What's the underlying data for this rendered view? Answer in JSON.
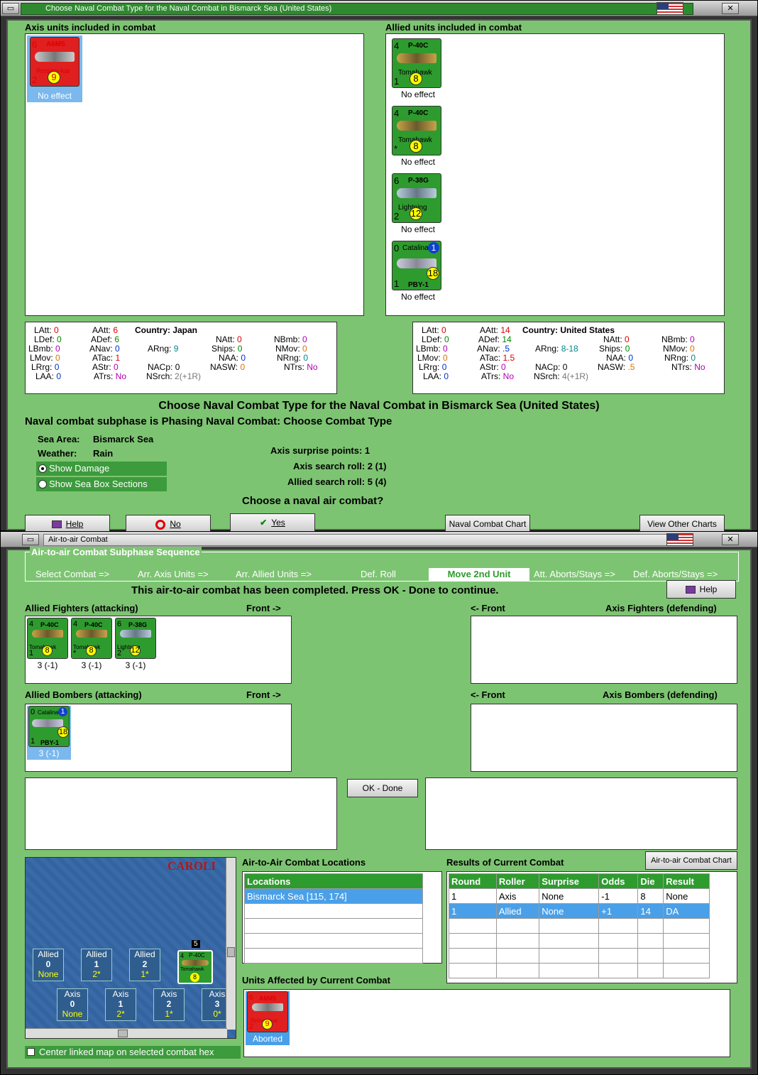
{
  "win1": {
    "title": "Choose Naval Combat Type for the Naval Combat in Bismarck Sea (United States)",
    "axis_label": "Axis units included in combat",
    "allied_label": "Allied units included in combat",
    "axis_units": [
      {
        "n1": "6",
        "name": "A6M5",
        "sub": "Reisen-kai",
        "n2": "2",
        "yellow": "9",
        "caption": "No effect"
      }
    ],
    "allied_units": [
      {
        "n1": "4",
        "name": "P-40C",
        "sub": "Tomahawk",
        "n2": "1",
        "yellow": "8",
        "caption": "No effect"
      },
      {
        "n1": "4",
        "name": "P-40C",
        "sub": "Tomahawk",
        "n2": "*",
        "yellow": "8",
        "caption": "No effect"
      },
      {
        "n1": "6",
        "name": "P-38G",
        "sub": "Lightning",
        "n2": "2",
        "yellow": "12",
        "caption": "No effect"
      },
      {
        "n1": "0",
        "name": "Catalina",
        "sub": "PBY-1",
        "n2": "1",
        "yellow": "18",
        "blue": "1",
        "caption": "No effect"
      }
    ],
    "axis_stats": {
      "latt": "0",
      "aatt": "6",
      "ldef": "0",
      "adef": "6",
      "lbmb": "0",
      "anav": "0",
      "lmov": "0",
      "atac": "1",
      "lrng": "0",
      "astr": "0",
      "laa": "0",
      "atrs": "No",
      "country": "Country: Japan",
      "arng": "9",
      "natt": "0",
      "ships": "0",
      "naa": "0",
      "nasw": "0",
      "nacp": "0",
      "nsrch": "2(+1R)",
      "nbmb": "0",
      "nmov": "0",
      "nrng": "0",
      "ntrs": "No"
    },
    "allied_stats": {
      "latt": "0",
      "aatt": "14",
      "ldef": "0",
      "adef": "14",
      "lbmb": "0",
      "anav": ".5",
      "lmov": "0",
      "atac": "1.5",
      "lrng": "0",
      "astr": "0",
      "laa": "0",
      "atrs": "No",
      "country": "Country: United States",
      "arng": "8-18",
      "natt": "0",
      "ships": "0",
      "naa": "0",
      "nasw": ".5",
      "nacp": "0",
      "nsrch": "4(+1R)",
      "nbmb": "0",
      "nmov": "0",
      "nrng": "0",
      "ntrs": "No"
    },
    "heading": "Choose Naval Combat Type for the Naval Combat in Bismarck Sea (United States)",
    "subheading": "Naval combat subphase is Phasing Naval Combat: Choose Combat Type",
    "sea_area_label": "Sea Area:",
    "sea_area": "Bismarck Sea",
    "weather_label": "Weather:",
    "weather": "Rain",
    "show_damage": "Show Damage",
    "show_sea_box": "Show Sea Box Sections",
    "axis_surprise": "Axis surprise points:  1",
    "axis_search": "Axis search roll:  2 (1)",
    "allied_search": "Allied search roll:  5 (4)",
    "question": "Choose a naval air combat?",
    "help": "Help",
    "no": "No",
    "yes": "Yes",
    "naval_chart": "Naval Combat Chart",
    "other_charts": "View Other Charts"
  },
  "win2": {
    "title": "Air-to-air Combat",
    "seq_title": "Air-to-air Combat Subphase Sequence",
    "seq": [
      "Select Combat =>",
      "Arr. Axis Units =>",
      "Arr. Allied Units =>",
      "Def. Roll",
      "Move 2nd Unit",
      "Att. Aborts/Stays =>",
      "Def. Aborts/Stays =>"
    ],
    "status": "This air-to-air combat has been completed.  Press OK - Done to continue.",
    "help": "Help",
    "allied_fighters": "Allied Fighters (attacking)",
    "front_r": "Front ->",
    "front_l": "<- Front",
    "axis_fighters": "Axis Fighters (defending)",
    "allied_bombers": "Allied Bombers (attacking)",
    "axis_bombers": "Axis Bombers (defending)",
    "fighters": [
      {
        "n1": "4",
        "name": "P-40C",
        "sub": "Tomahawk",
        "n2": "1",
        "yellow": "8",
        "caption": "3 (-1)"
      },
      {
        "n1": "4",
        "name": "P-40C",
        "sub": "Tomahawk",
        "n2": "*",
        "yellow": "8",
        "caption": "3 (-1)"
      },
      {
        "n1": "6",
        "name": "P-38G",
        "sub": "Lightning",
        "n2": "2",
        "yellow": "12",
        "caption": "3 (-1)"
      }
    ],
    "bomber": {
      "n1": "0",
      "name": "Catalina",
      "sub": "PBY-1",
      "n2": "1",
      "yellow": "18",
      "blue": "1",
      "caption": "3 (-1)"
    },
    "ok_done": "OK - Done",
    "map_label": "CAROLI",
    "boxes_allied": [
      {
        "t": "Allied",
        "v": "0",
        "s": "None"
      },
      {
        "t": "Allied",
        "v": "1",
        "s": "2*"
      },
      {
        "t": "Allied",
        "v": "2",
        "s": "1*"
      }
    ],
    "boxes_axis": [
      {
        "t": "Axis",
        "v": "0",
        "s": "None"
      },
      {
        "t": "Axis",
        "v": "1",
        "s": "2*"
      },
      {
        "t": "Axis",
        "v": "2",
        "s": "1*"
      },
      {
        "t": "Axis",
        "v": "3",
        "s": "0*"
      }
    ],
    "map_unit": {
      "n1": "4",
      "name": "P-40C",
      "sub": "Tomahawk",
      "yellow": "8",
      "stack": "5"
    },
    "center_map": "Center linked map on selected combat hex",
    "locations_title": "Air-to-Air Combat Locations",
    "locations_header": "Locations",
    "locations": [
      "Bismarck Sea [115, 174]"
    ],
    "results_title": "Results of Current Combat",
    "chart_btn": "Air-to-air Combat Chart",
    "results_header": [
      "Round",
      "Roller",
      "Surprise",
      "Odds",
      "Die",
      "Result"
    ],
    "results": [
      [
        "1",
        "Axis",
        "None",
        "-1",
        "8",
        "None"
      ],
      [
        "1",
        "Allied",
        "None",
        "+1",
        "14",
        "DA"
      ]
    ],
    "affected_title": "Units Affected by Current Combat",
    "affected_unit": {
      "n1": "6",
      "name": "A6M5",
      "sub": "Reisen-kai",
      "n2": "2",
      "yellow": "9",
      "caption": "Aborted"
    }
  }
}
